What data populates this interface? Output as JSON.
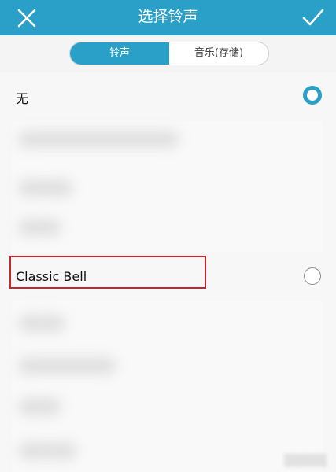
{
  "header": {
    "title": "选择铃声",
    "close_icon": "close-icon",
    "confirm_icon": "check-icon",
    "color": "#2a9fc8"
  },
  "tabs": [
    {
      "label": "铃声",
      "active": true
    },
    {
      "label": "音乐(存储)",
      "active": false
    }
  ],
  "list": {
    "none_label": "无",
    "none_selected": true,
    "classic_label": "Classic Bell",
    "classic_selected": false
  }
}
